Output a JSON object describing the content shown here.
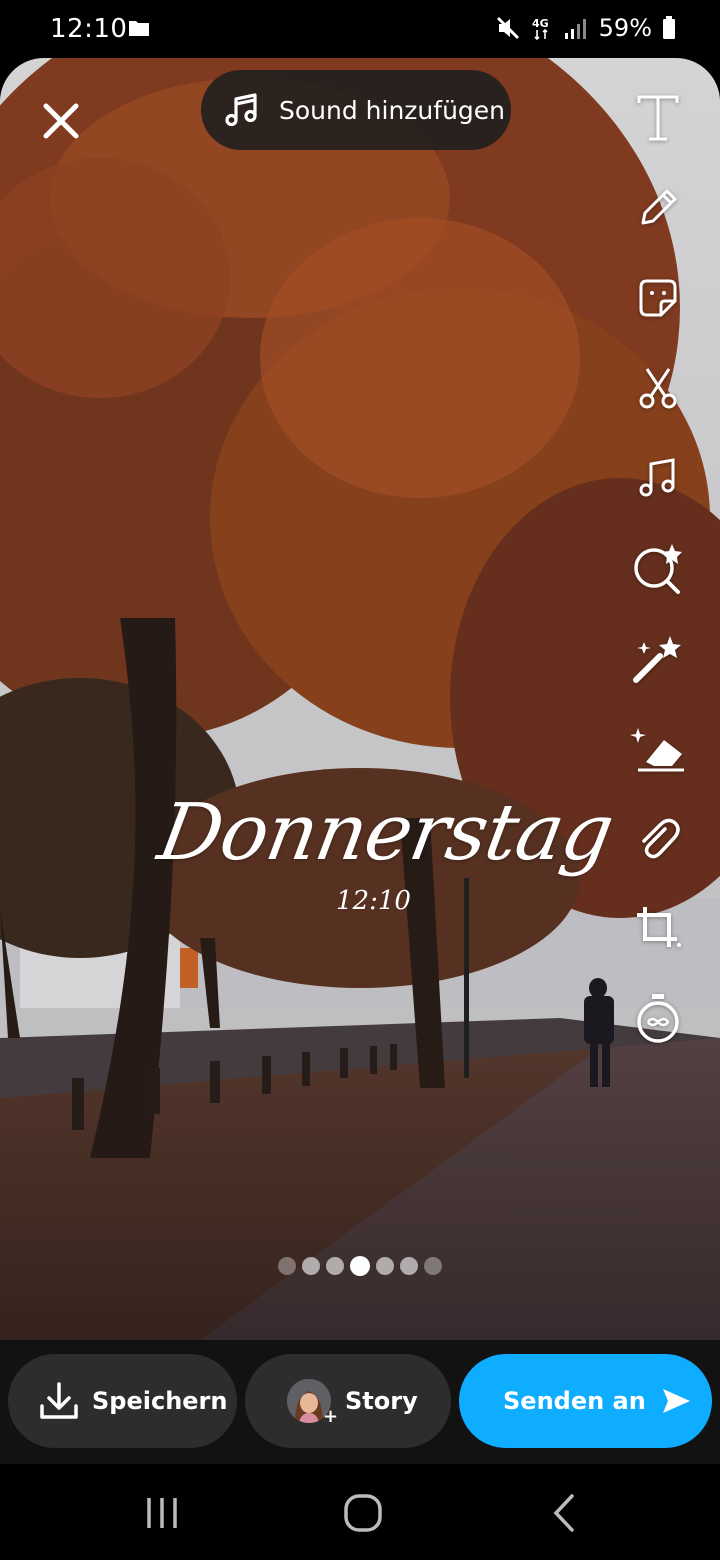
{
  "status_bar": {
    "time": "12:10",
    "battery": "59%",
    "icons": [
      "folder-icon",
      "mute-icon",
      "4g-icon",
      "signal-icon",
      "battery-icon"
    ]
  },
  "top": {
    "close_icon": "close-icon",
    "sound_label": "Sound hinzufügen",
    "sound_icon": "music-note-icon"
  },
  "toolbar": {
    "tools": [
      "text-icon",
      "pencil-icon",
      "sticker-icon",
      "scissors-icon",
      "music-icon",
      "lens-search-icon",
      "magic-wand-icon",
      "eraser-icon",
      "paperclip-icon",
      "crop-icon",
      "timer-icon"
    ]
  },
  "sticker": {
    "day": "Donnerstag",
    "time": "12:10"
  },
  "pager": {
    "count": 7,
    "active_index": 3
  },
  "actions": {
    "save_label": "Speichern",
    "story_label": "Story",
    "send_label": "Senden an"
  },
  "colors": {
    "send_button": "#0fadff",
    "pill": "#2d2d2d"
  }
}
